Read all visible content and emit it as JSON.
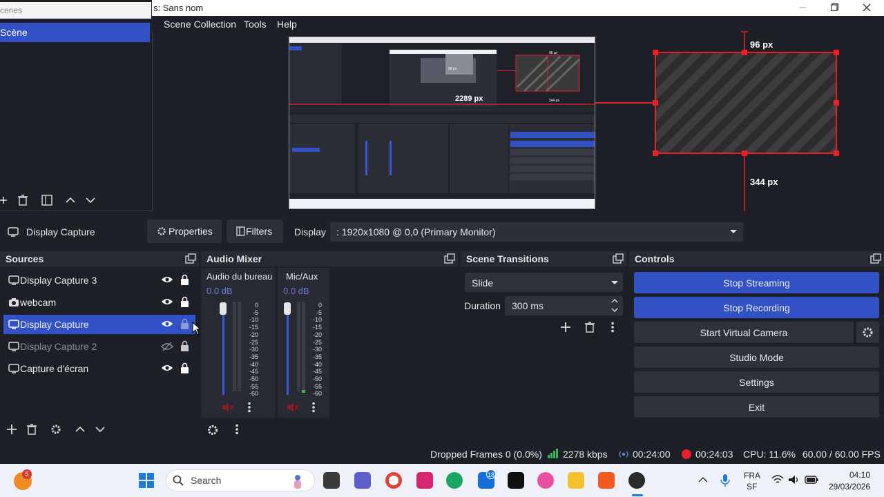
{
  "window": {
    "title": "s: Sans nom"
  },
  "menu": {
    "items": [
      "Scene Collection",
      "Tools",
      "Help"
    ]
  },
  "scenes": {
    "header": "cenes",
    "items": [
      "Scène"
    ]
  },
  "preview": {
    "measure_top": "96 px",
    "measure_bottom": "344 px",
    "inner_measure": "2289 px",
    "inner_small_top": "96 px",
    "inner_small_bottom": "344 px"
  },
  "source_toolbar": {
    "source_name": "Display Capture",
    "properties_label": "Properties",
    "filters_label": "Filters",
    "display_label": "Display",
    "display_value": ": 1920x1080 @ 0,0 (Primary Monitor)"
  },
  "sources": {
    "title": "Sources",
    "items": [
      {
        "name": "Display Capture 3",
        "icon": "monitor-icon",
        "visible": true,
        "locked": true
      },
      {
        "name": "webcam",
        "icon": "camera-icon",
        "visible": true,
        "locked": true
      },
      {
        "name": "Display Capture",
        "icon": "monitor-icon",
        "visible": true,
        "locked": false,
        "selected": true
      },
      {
        "name": "Display Capture 2",
        "icon": "monitor-icon",
        "visible": false,
        "locked": true
      },
      {
        "name": "Capture d'écran",
        "icon": "monitor-icon",
        "visible": true,
        "locked": true
      }
    ]
  },
  "audio_mixer": {
    "title": "Audio Mixer",
    "channels": [
      {
        "name": "Audio du bureau",
        "level": "0.0 dB"
      },
      {
        "name": "Mic/Aux",
        "level": "0.0 dB"
      }
    ],
    "scale": [
      "0",
      "-5",
      "-10",
      "-15",
      "-20",
      "-25",
      "-30",
      "-35",
      "-40",
      "-45",
      "-50",
      "-55",
      "-60"
    ]
  },
  "transitions": {
    "title": "Scene Transitions",
    "selected": "Slide",
    "duration_label": "Duration",
    "duration_value": "300 ms"
  },
  "controls": {
    "title": "Controls",
    "buttons": [
      "Stop Streaming",
      "Stop Recording",
      "Start Virtual Camera",
      "Studio Mode",
      "Settings",
      "Exit"
    ]
  },
  "status": {
    "dropped": "Dropped Frames 0 (0.0%)",
    "bitrate": "2278 kbps",
    "stream_time": "00:24:00",
    "rec_time": "00:24:03",
    "cpu": "CPU: 11.6%",
    "fps": "60.00 / 60.00 FPS"
  },
  "taskbar": {
    "search_placeholder": "Search",
    "badge_count": "5",
    "teams_badge": "18",
    "lang_top": "FRA",
    "lang_bottom": "SF",
    "time": "04:10",
    "date": "29/03/2026"
  },
  "colors": {
    "accent": "#3251c4",
    "bg": "#1e2027",
    "red": "#e8202a"
  }
}
